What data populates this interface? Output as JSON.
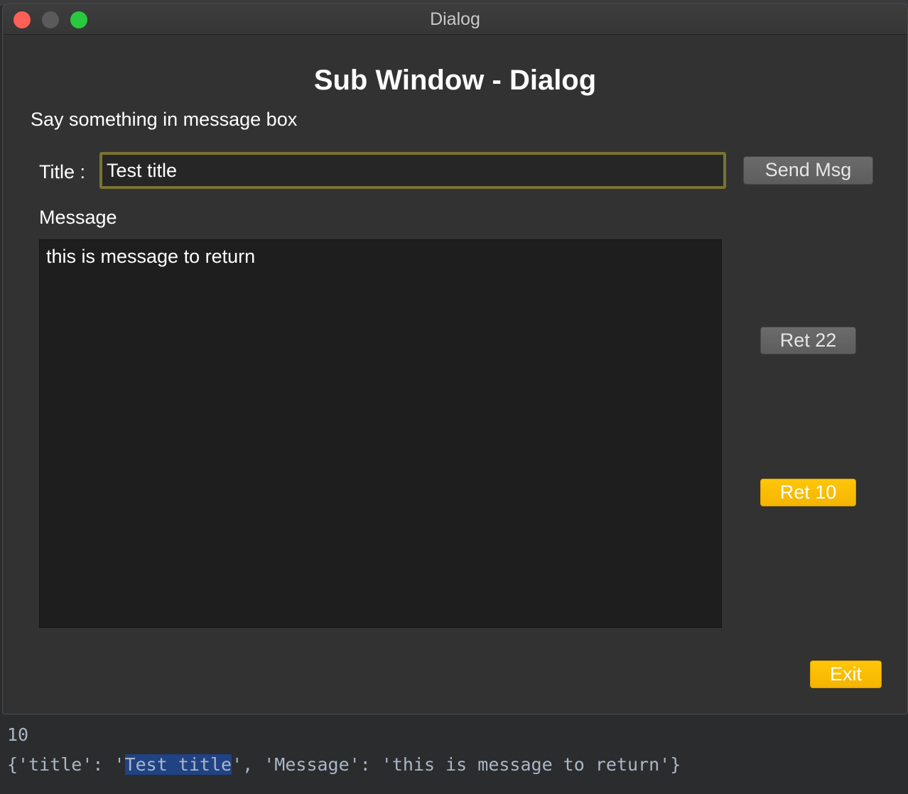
{
  "window": {
    "title": "Dialog"
  },
  "dialog": {
    "heading": "Sub Window - Dialog",
    "subtitle": "Say something in message box",
    "title_label": "Title :",
    "title_value": "Test title",
    "send_button": "Send Msg",
    "message_label": "Message",
    "message_value": "this is message to return",
    "ret22_button": "Ret 22",
    "ret10_button": "Ret 10",
    "exit_button": "Exit"
  },
  "console": {
    "line1": "10",
    "line2_prefix": "{'title': '",
    "line2_highlight": "Test title",
    "line2_suffix": "', 'Message': 'this is message to return'}"
  },
  "colors": {
    "accent_yellow": "#ffc60a",
    "input_focus_border": "#7a7331",
    "close": "#fe5f57",
    "maximize": "#29c93f",
    "selection": "#214283"
  }
}
